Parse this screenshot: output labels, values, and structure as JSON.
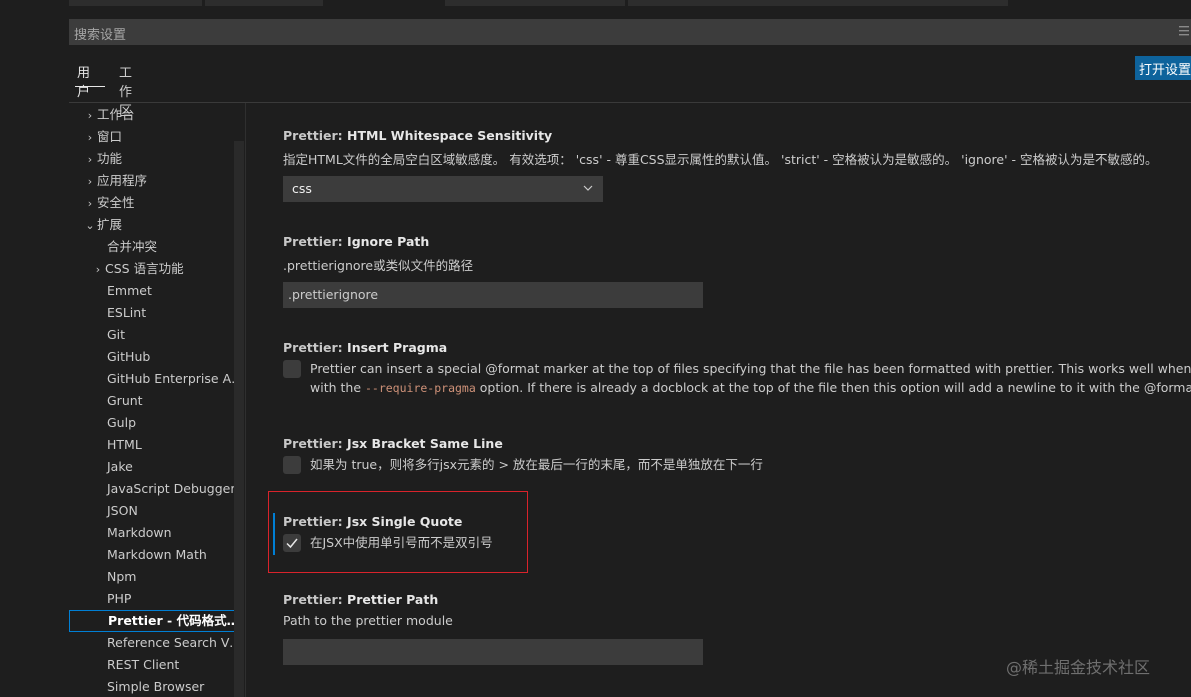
{
  "search": {
    "placeholder": "搜索设置"
  },
  "tabs": [
    {
      "label": "用户",
      "active": true
    },
    {
      "label": "工作区",
      "active": false
    }
  ],
  "open_settings_button": "打开设置",
  "toc": {
    "items": [
      {
        "label": "工作台",
        "chevron": "›",
        "level": 0
      },
      {
        "label": "窗口",
        "chevron": "›",
        "level": 0
      },
      {
        "label": "功能",
        "chevron": "›",
        "level": 0
      },
      {
        "label": "应用程序",
        "chevron": "›",
        "level": 0
      },
      {
        "label": "安全性",
        "chevron": "›",
        "level": 0
      },
      {
        "label": "扩展",
        "chevron": "⌄",
        "level": 0
      },
      {
        "label": "合并冲突",
        "chevron": "",
        "level": 1
      },
      {
        "label": "CSS 语言功能",
        "chevron": "›",
        "level": 1
      },
      {
        "label": "Emmet",
        "chevron": "",
        "level": 1
      },
      {
        "label": "ESLint",
        "chevron": "",
        "level": 1
      },
      {
        "label": "Git",
        "chevron": "",
        "level": 1
      },
      {
        "label": "GitHub",
        "chevron": "",
        "level": 1
      },
      {
        "label": "GitHub Enterprise Aut...",
        "chevron": "",
        "level": 1
      },
      {
        "label": "Grunt",
        "chevron": "",
        "level": 1
      },
      {
        "label": "Gulp",
        "chevron": "",
        "level": 1
      },
      {
        "label": "HTML",
        "chevron": "",
        "level": 1
      },
      {
        "label": "Jake",
        "chevron": "",
        "level": 1
      },
      {
        "label": "JavaScript Debugger",
        "chevron": "",
        "level": 1
      },
      {
        "label": "JSON",
        "chevron": "",
        "level": 1
      },
      {
        "label": "Markdown",
        "chevron": "",
        "level": 1
      },
      {
        "label": "Markdown Math",
        "chevron": "",
        "level": 1
      },
      {
        "label": "Npm",
        "chevron": "",
        "level": 1
      },
      {
        "label": "PHP",
        "chevron": "",
        "level": 1
      },
      {
        "label": "Prettier - 代码格式化...",
        "chevron": "",
        "level": 1,
        "selected": true
      },
      {
        "label": "Reference Search View",
        "chevron": "",
        "level": 1
      },
      {
        "label": "REST Client",
        "chevron": "",
        "level": 1
      },
      {
        "label": "Simple Browser",
        "chevron": "",
        "level": 1
      }
    ]
  },
  "settings": {
    "html_whitespace": {
      "category": "Prettier: ",
      "name": "HTML Whitespace Sensitivity",
      "description": "指定HTML文件的全局空白区域敏感度。 有效选项： 'css' - 尊重CSS显示属性的默认值。 'strict' - 空格被认为是敏感的。 'ignore' - 空格被认为是不敏感的。",
      "value": "css"
    },
    "ignore_path": {
      "category": "Prettier: ",
      "name": "Ignore Path",
      "description": ".prettierignore或类似文件的路径",
      "value": ".prettierignore"
    },
    "insert_pragma": {
      "category": "Prettier: ",
      "name": "Insert Pragma",
      "line1": "Prettier can insert a special @format marker at the top of files specifying that the file has been formatted with prettier. This works well when used in tande",
      "line2_pre": "with the ",
      "line2_code": "--require-pragma",
      "line2_post": " option. If there is already a docblock at the top of the file then this option will add a newline to it with the @format marker.",
      "checked": false
    },
    "jsx_bracket": {
      "category": "Prettier: ",
      "name": "Jsx Bracket Same Line",
      "description": "如果为 true，则将多行jsx元素的 > 放在最后一行的末尾，而不是单独放在下一行",
      "checked": false
    },
    "jsx_single_quote": {
      "category": "Prettier: ",
      "name": "Jsx Single Quote",
      "description": "在JSX中使用单引号而不是双引号",
      "checked": true
    },
    "prettier_path": {
      "category": "Prettier: ",
      "name": "Prettier Path",
      "description": "Path to the prettier module",
      "value": ""
    }
  },
  "watermark": "@稀土掘金技术社区",
  "colors": {
    "accent": "#007fd4",
    "button": "#0e639c",
    "highlight": "#d9232b"
  }
}
